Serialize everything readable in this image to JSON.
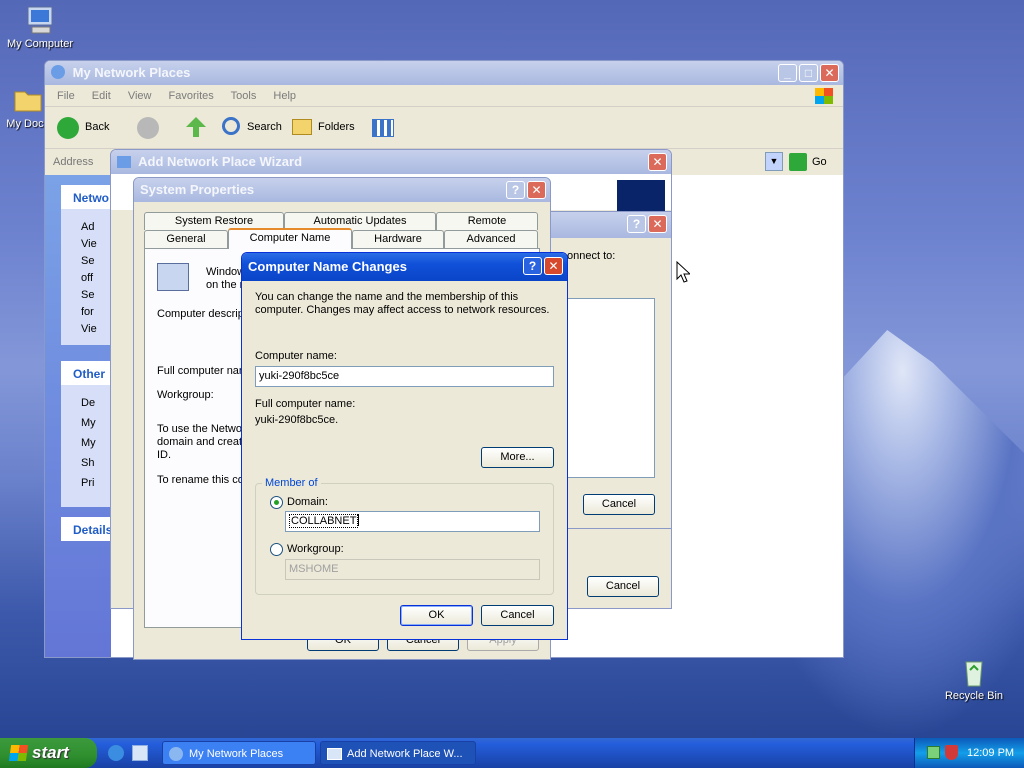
{
  "desktop": {
    "icons": [
      {
        "label": "My Computer"
      },
      {
        "label": "My Docu"
      },
      {
        "label": "Recycle Bin"
      }
    ]
  },
  "network_window": {
    "title": "My Network Places",
    "menu": [
      "File",
      "Edit",
      "View",
      "Favorites",
      "Tools",
      "Help"
    ],
    "toolbar": {
      "back": "Back",
      "search": "Search",
      "folders": "Folders"
    },
    "address_label": "Address",
    "go": "Go",
    "left_panes": {
      "network_tasks": "Netwo",
      "items1": [
        "Ad",
        "Vie",
        "Se",
        "off",
        "Se",
        "for",
        "Vie"
      ],
      "other": "Other",
      "items2": [
        "De",
        "My",
        "My",
        "Sh",
        "Pri"
      ],
      "details": "Details"
    }
  },
  "wizard": {
    "title": "Add Network Place Wizard"
  },
  "inner_dialog": {
    "connect_text": "onnect to:",
    "cancel": "Cancel",
    "cancel2": "Cancel"
  },
  "sysprops": {
    "title": "System Properties",
    "tabs_top": [
      "System Restore",
      "Automatic Updates",
      "Remote"
    ],
    "tabs_bottom": [
      "General",
      "Computer Name",
      "Hardware",
      "Advanced"
    ],
    "texts": {
      "windows": "Window",
      "on": "on the r",
      "desc": "Computer descript",
      "full": "Full computer nam",
      "workgroup": "Workgroup:",
      "use1": "To use the Netwo",
      "use2": "domain and create",
      "use3": "ID.",
      "rename": "To rename this co"
    },
    "ok": "OK",
    "cancel": "Cancel",
    "apply": "Apply"
  },
  "cnc": {
    "title": "Computer Name Changes",
    "intro1": "You can change the name and the membership of this",
    "intro2": "computer. Changes may affect access to network resources.",
    "computer_name_label": "Computer name:",
    "computer_name": "yuki-290f8bc5ce",
    "full_label": "Full computer name:",
    "full_value": "yuki-290f8bc5ce.",
    "more": "More...",
    "member_of": "Member of",
    "domain_label": "Domain:",
    "domain_value": "COLLABNET",
    "workgroup_label": "Workgroup:",
    "workgroup_value": "MSHOME",
    "ok": "OK",
    "cancel": "Cancel"
  },
  "taskbar": {
    "start": "start",
    "items": [
      "My Network Places",
      "Add Network Place W..."
    ],
    "time": "12:09 PM"
  }
}
